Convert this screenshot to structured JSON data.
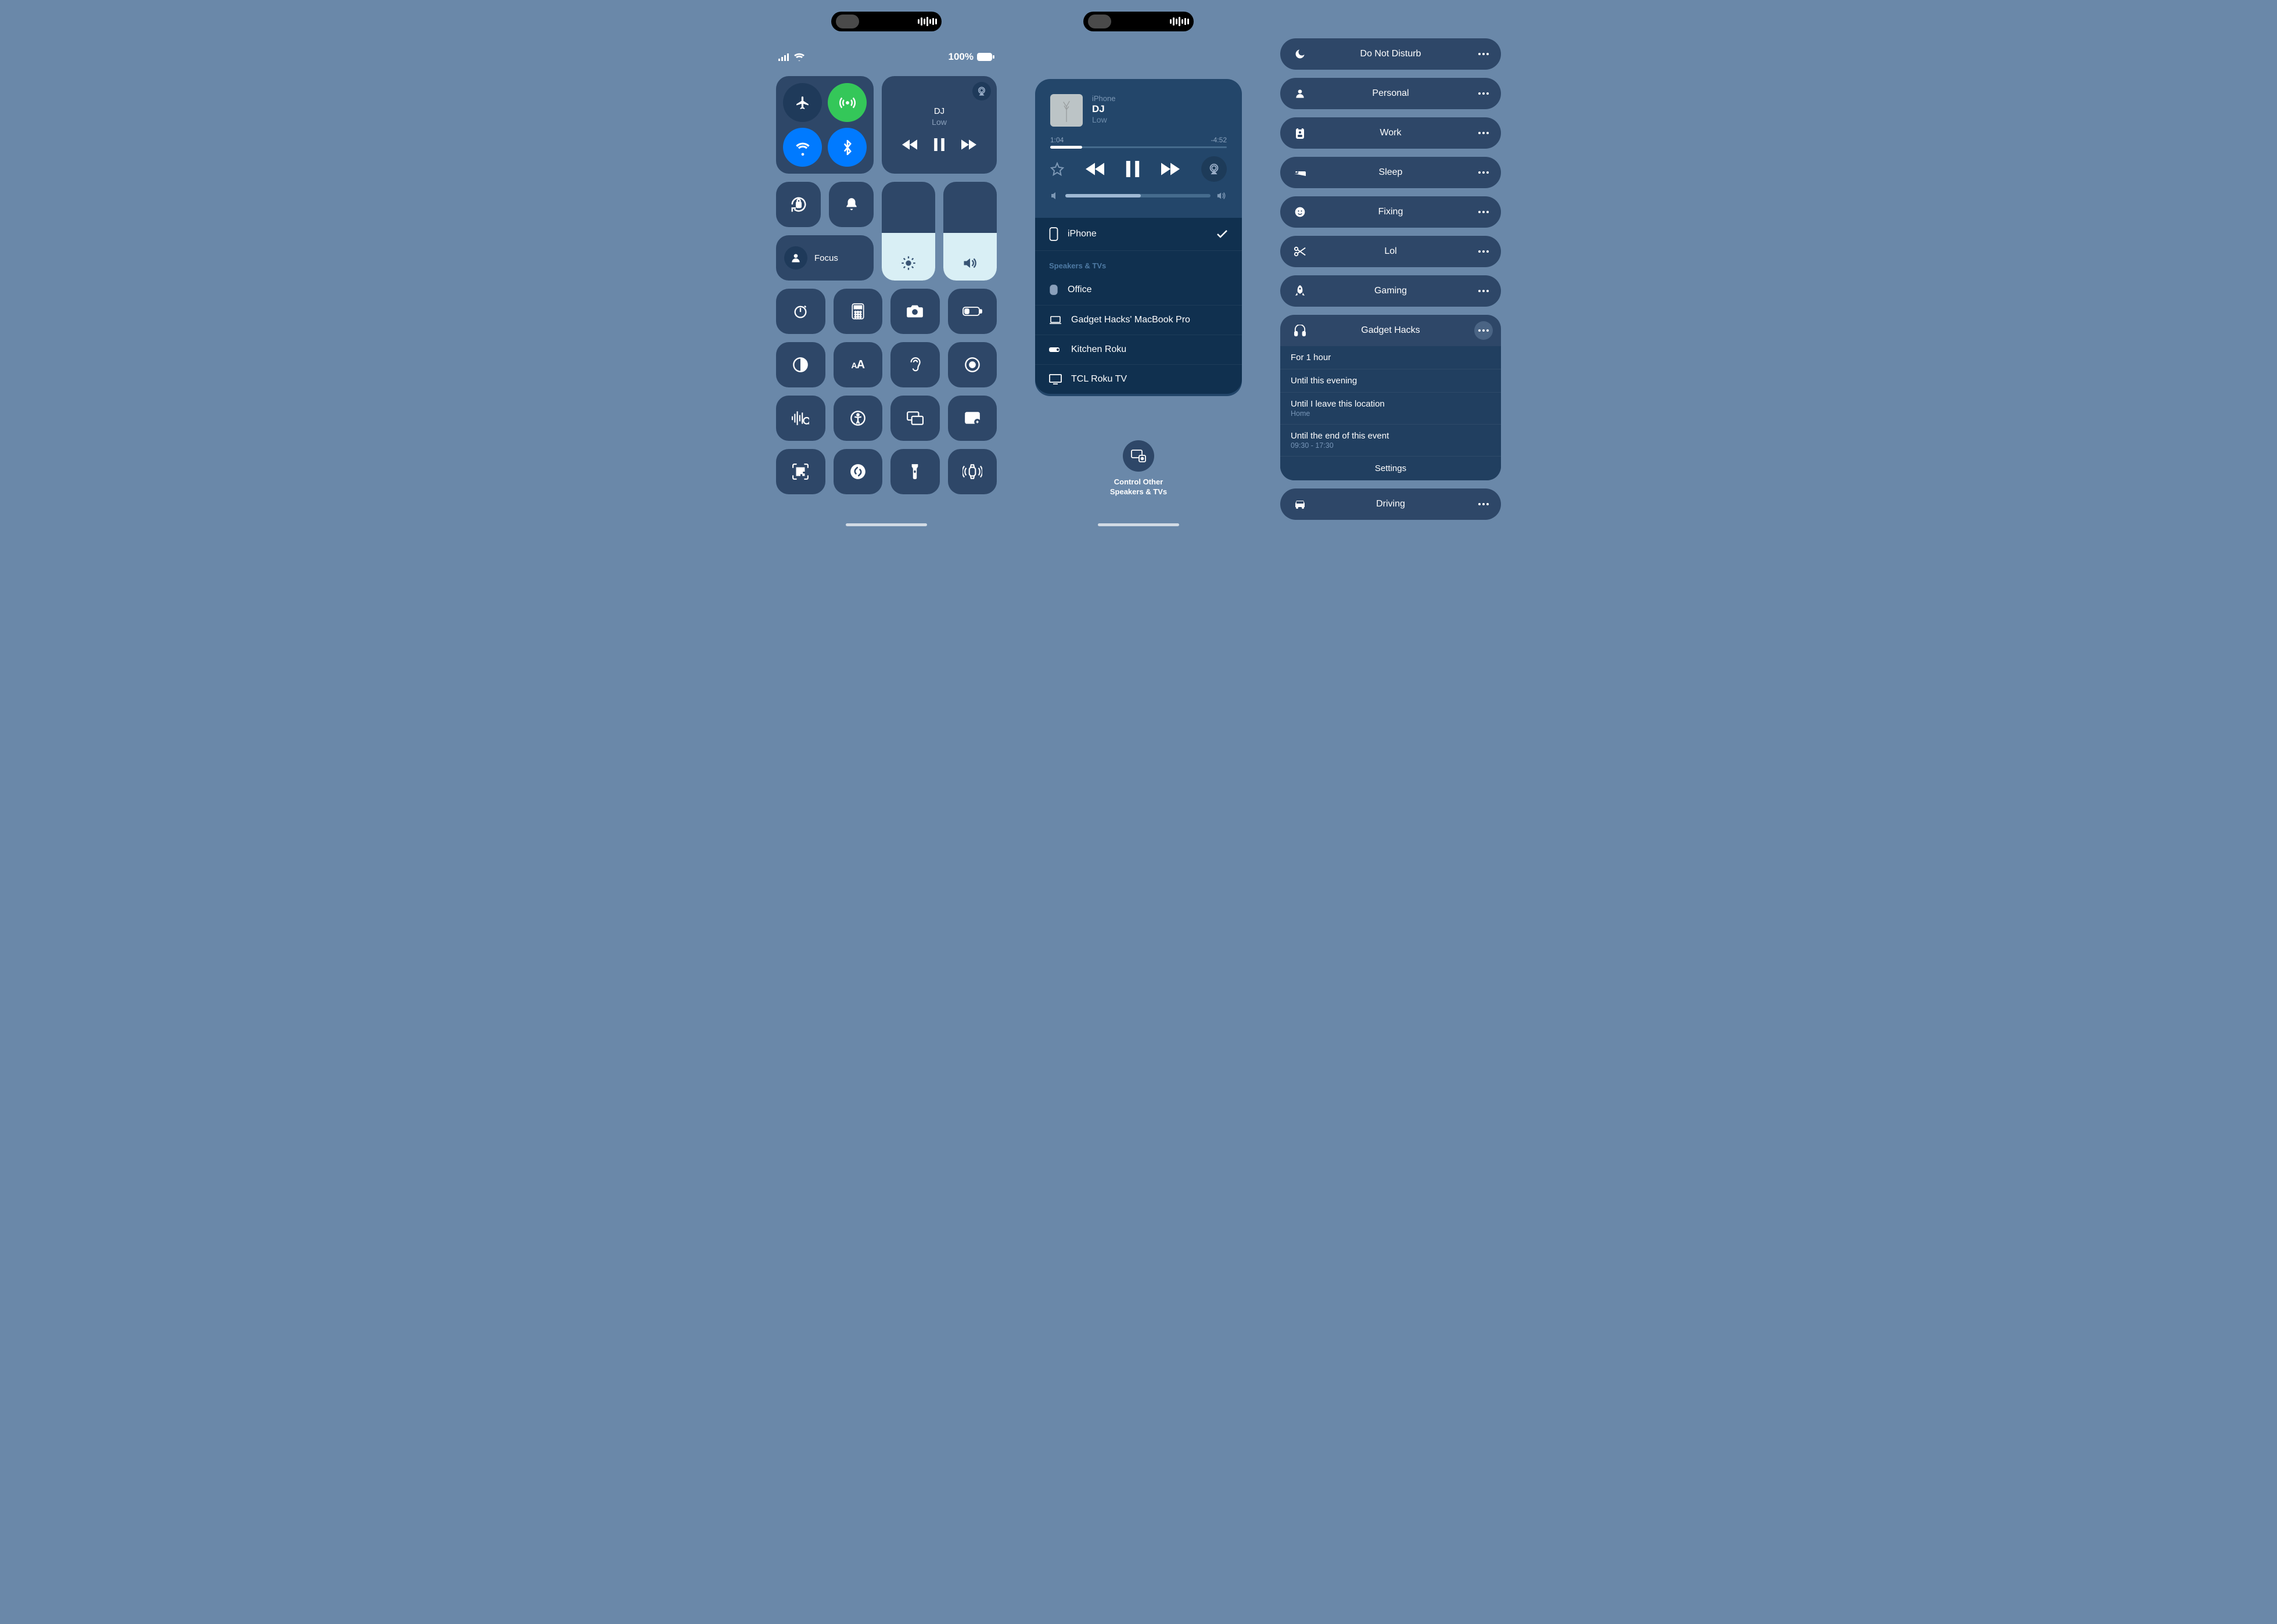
{
  "status": {
    "battery_pct": "100%",
    "signal_bars": 4
  },
  "media": {
    "title": "DJ",
    "subtitle": "Low"
  },
  "focus_pill": {
    "label": "Focus"
  },
  "brightness_pct": 48,
  "volume_pct": 48,
  "airplay": {
    "source": "iPhone",
    "title": "DJ",
    "subtitle": "Low",
    "elapsed": "1:04",
    "remaining": "-4:52",
    "progress_pct": 18,
    "volume_pct": 52,
    "section_header": "Speakers & TVs",
    "this_device": "iPhone",
    "devices": [
      {
        "name": "Office",
        "icon": "homepod"
      },
      {
        "name": "Gadget Hacks' MacBook Pro",
        "icon": "laptop"
      },
      {
        "name": "Kitchen Roku",
        "icon": "stick"
      },
      {
        "name": "TCL Roku TV",
        "icon": "tv"
      }
    ],
    "footer_line1": "Control Other",
    "footer_line2": "Speakers & TVs"
  },
  "focus_modes": {
    "items": [
      {
        "label": "Do Not Disturb",
        "icon": "moon"
      },
      {
        "label": "Personal",
        "icon": "person"
      },
      {
        "label": "Work",
        "icon": "badge"
      },
      {
        "label": "Sleep",
        "icon": "bed"
      },
      {
        "label": "Fixing",
        "icon": "smile"
      },
      {
        "label": "Lol",
        "icon": "scissors"
      },
      {
        "label": "Gaming",
        "icon": "rocket"
      }
    ],
    "expanded": {
      "label": "Gadget Hacks",
      "icon": "headphones",
      "options": [
        {
          "text": "For 1 hour"
        },
        {
          "text": "Until this evening"
        },
        {
          "text": "Until I leave this location",
          "sub": "Home"
        },
        {
          "text": "Until the end of this event",
          "sub": "09:30 - 17:30"
        }
      ],
      "settings_label": "Settings"
    },
    "last": {
      "label": "Driving",
      "icon": "car"
    }
  }
}
